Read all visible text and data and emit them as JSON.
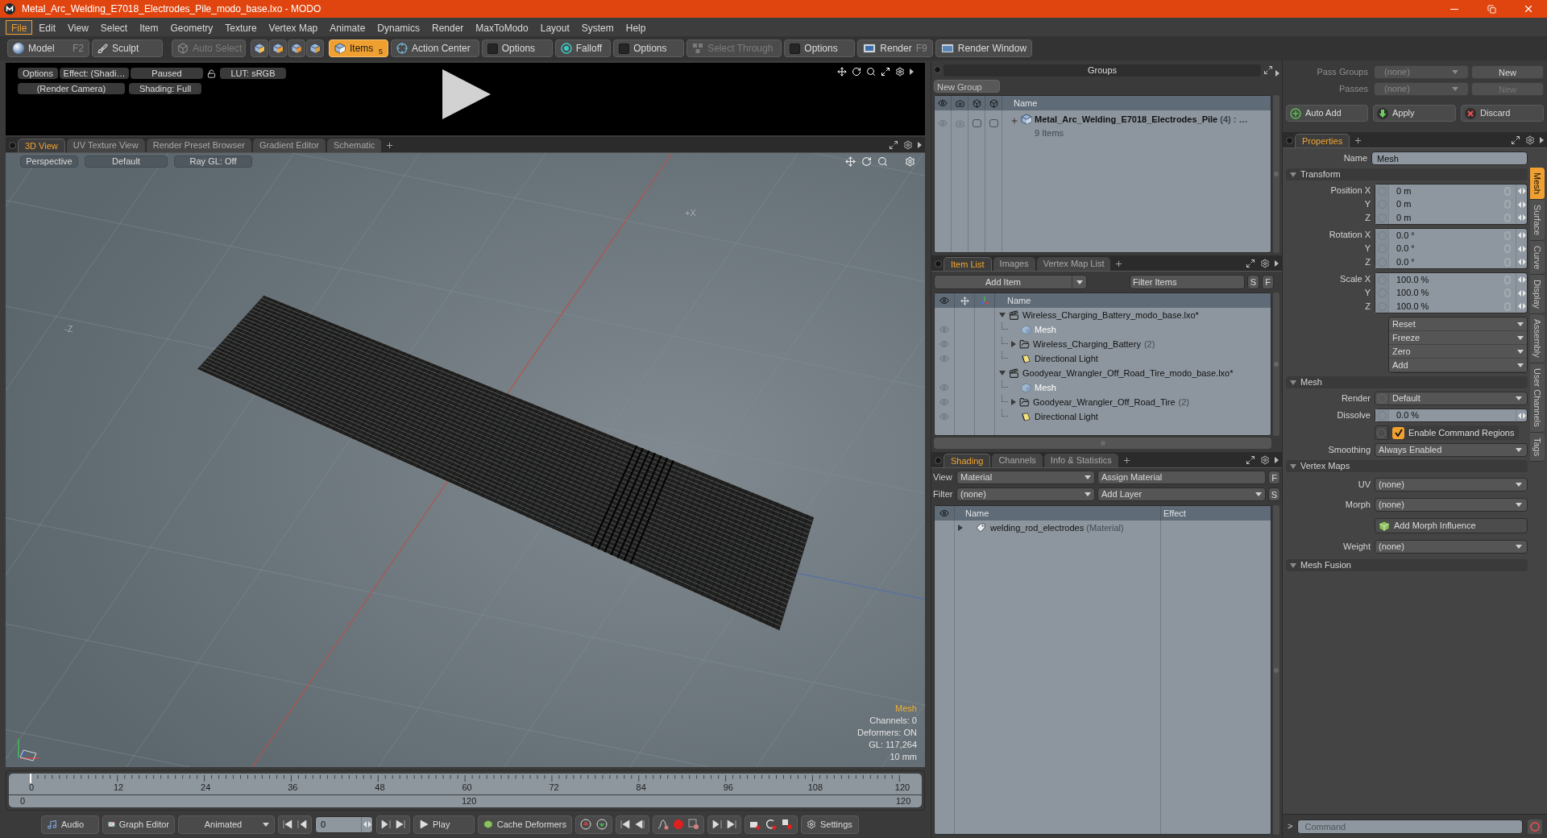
{
  "window": {
    "title": "Metal_Arc_Welding_E7018_Electrodes_Pile_modo_base.lxo - MODO"
  },
  "menu": [
    {
      "label": "File",
      "selected": true
    },
    {
      "label": "Edit",
      "selected": false
    },
    {
      "label": "View",
      "selected": false
    },
    {
      "label": "Select",
      "selected": false
    },
    {
      "label": "Item",
      "selected": false
    },
    {
      "label": "Geometry",
      "selected": false
    },
    {
      "label": "Texture",
      "selected": false
    },
    {
      "label": "Vertex Map",
      "selected": false
    },
    {
      "label": "Animate",
      "selected": false
    },
    {
      "label": "Dynamics",
      "selected": false
    },
    {
      "label": "Render",
      "selected": false
    },
    {
      "label": "MaxToModo",
      "selected": false
    },
    {
      "label": "Layout",
      "selected": false
    },
    {
      "label": "System",
      "selected": false
    },
    {
      "label": "Help",
      "selected": false
    }
  ],
  "toolbar": {
    "modes": [
      {
        "label": "Model",
        "shortcut": "F2"
      },
      {
        "label": "Sculpt"
      }
    ],
    "auto_select": {
      "label": "Auto Select",
      "disabled": true
    },
    "selection_modes": [
      {
        "selected": false
      },
      {
        "selected": false
      },
      {
        "selected": false
      },
      {
        "selected": false
      },
      {
        "label": "Items",
        "count": "5",
        "selected": true
      }
    ],
    "tools": [
      {
        "kind": "action_center",
        "label": "Action Center",
        "disabled": false
      },
      {
        "kind": "options",
        "label": "Options",
        "disabled": false
      },
      {
        "kind": "falloff",
        "label": "Falloff",
        "disabled": false
      },
      {
        "kind": "options",
        "label": "Options",
        "disabled": false
      },
      {
        "kind": "select_through",
        "label": "Select Through",
        "disabled": true
      },
      {
        "kind": "options",
        "label": "Options",
        "disabled": false
      }
    ],
    "render": [
      {
        "kind": "render",
        "label": "Render",
        "shortcut": "F9"
      },
      {
        "kind": "render_window",
        "label": "Render Window"
      }
    ]
  },
  "preview": {
    "row_1": [
      "Options",
      "Effect: (Shadi…",
      "Paused"
    ],
    "lut": "LUT: sRGB",
    "row_2": [
      "(Render Camera)",
      "Shading: Full"
    ]
  },
  "viewport": {
    "tabs": [
      {
        "label": "3D View",
        "selected": true
      },
      {
        "label": "UV Texture View",
        "selected": false
      },
      {
        "label": "Render Preset Browser",
        "selected": false
      },
      {
        "label": "Gradient Editor",
        "selected": false
      },
      {
        "label": "Schematic",
        "selected": false
      }
    ],
    "buttons": [
      "Perspective",
      "Default",
      "Ray GL: Off"
    ],
    "axis_labels": [
      "+X",
      "-Z"
    ],
    "info": {
      "title": "Mesh",
      "lines": [
        "Channels: 0",
        "Deformers: ON",
        "GL: 117,264",
        "10 mm"
      ]
    }
  },
  "timeline": {
    "ticks": [
      "0",
      "12",
      "24",
      "36",
      "48",
      "60",
      "72",
      "84",
      "96",
      "108",
      "120"
    ],
    "range": [
      "0",
      "120",
      "120"
    ]
  },
  "transport": {
    "audio": "Audio",
    "graph_editor": "Graph Editor",
    "mode": "Animated",
    "frame": "0",
    "play": "Play",
    "cache": "Cache Deformers",
    "settings": "Settings"
  },
  "groups": {
    "title": "Groups",
    "new_group": "New Group",
    "column": "Name",
    "rows": [
      {
        "name": "Metal_Arc_Welding_E7018_Electrodes_Pile",
        "count": "(4) : …",
        "subtitle": "9 Items",
        "expanded": false
      }
    ]
  },
  "item_list": {
    "tabs": [
      {
        "label": "Item List",
        "selected": true
      },
      {
        "label": "Images",
        "selected": false
      },
      {
        "label": "Vertex Map List",
        "selected": false
      }
    ],
    "add_item": "Add Item",
    "filter_placeholder": "Filter Items",
    "buttons": [
      "S",
      "F"
    ],
    "column": "Name",
    "tree": [
      {
        "kind": "scene",
        "name": "Wireless_Charging_Battery_modo_base.lxo*",
        "expanded": true,
        "children": [
          {
            "kind": "mesh",
            "name": "Mesh",
            "dimmed": true
          },
          {
            "kind": "group",
            "name": "Wireless_Charging_Battery",
            "count": "(2)",
            "expanded": false,
            "dimmed": false
          },
          {
            "kind": "light",
            "name": "Directional Light",
            "dimmed": false
          }
        ]
      },
      {
        "kind": "scene",
        "name": "Goodyear_Wrangler_Off_Road_Tire_modo_base.lxo*",
        "expanded": true,
        "children": [
          {
            "kind": "mesh",
            "name": "Mesh",
            "dimmed": true
          },
          {
            "kind": "group",
            "name": "Goodyear_Wrangler_Off_Road_Tire",
            "count": "(2)",
            "expanded": false,
            "dimmed": false
          },
          {
            "kind": "light",
            "name": "Directional Light",
            "dimmed": false
          }
        ]
      }
    ]
  },
  "shading": {
    "tabs": [
      {
        "label": "Shading",
        "selected": true
      },
      {
        "label": "Channels",
        "selected": false
      },
      {
        "label": "Info & Statistics",
        "selected": false
      }
    ],
    "view_label": "View",
    "view": "Material",
    "assign": "Assign Material",
    "filter_label": "Filter",
    "filter": "(none)",
    "add_layer": "Add Layer",
    "buttons": [
      "F",
      "S"
    ],
    "columns": [
      "Name",
      "Effect"
    ],
    "rows": [
      {
        "name": "welding_rod_electrodes",
        "type": "(Material)",
        "expanded": false
      }
    ]
  },
  "passes": {
    "rows": [
      {
        "label": "Pass Groups",
        "value": "(none)",
        "button": "New",
        "disabled": false
      },
      {
        "label": "Passes",
        "value": "(none)",
        "button": "New",
        "disabled": true
      }
    ],
    "actions": [
      {
        "kind": "add",
        "label": "Auto Add"
      },
      {
        "kind": "apply",
        "label": "Apply"
      },
      {
        "kind": "discard",
        "label": "Discard"
      }
    ]
  },
  "properties": {
    "tabs": [
      {
        "label": "Properties",
        "selected": true
      }
    ],
    "name_label": "Name",
    "name": "Mesh",
    "sections": [
      {
        "title": "Transform",
        "expanded": true,
        "rows": [
          {
            "kind": "vector",
            "items": [
              {
                "label": "Position X",
                "value": "0 m"
              },
              {
                "label": "Y",
                "value": "0 m"
              },
              {
                "label": "Z",
                "value": "0 m"
              }
            ]
          },
          {
            "kind": "vector",
            "items": [
              {
                "label": "Rotation X",
                "value": "0.0 °"
              },
              {
                "label": "Y",
                "value": "0.0 °"
              },
              {
                "label": "Z",
                "value": "0.0 °"
              }
            ]
          },
          {
            "kind": "vector",
            "items": [
              {
                "label": "Scale X",
                "value": "100.0 %"
              },
              {
                "label": "Y",
                "value": "100.0 %"
              },
              {
                "label": "Z",
                "value": "100.0 %"
              }
            ]
          },
          {
            "kind": "menus",
            "items": [
              "Reset",
              "Freeze",
              "Zero",
              "Add"
            ]
          }
        ]
      },
      {
        "title": "Mesh",
        "expanded": true,
        "rows": [
          {
            "kind": "channel_dropdown",
            "label": "Render",
            "value": "Default"
          },
          {
            "kind": "number",
            "label": "Dissolve",
            "value": "0.0 %"
          },
          {
            "kind": "checkbox",
            "label": "Enable Command Regions",
            "checked": true
          },
          {
            "kind": "dropdown",
            "label": "Smoothing",
            "value": "Always Enabled"
          }
        ]
      },
      {
        "title": "Vertex Maps",
        "expanded": true,
        "rows": [
          {
            "kind": "dropdown",
            "label": "UV",
            "value": "(none)"
          },
          {
            "kind": "dropdown",
            "label": "Morph",
            "value": "(none)"
          },
          {
            "kind": "button",
            "label": "Add Morph Influence"
          },
          {
            "kind": "dropdown",
            "label": "Weight",
            "value": "(none)"
          }
        ]
      },
      {
        "title": "Mesh Fusion",
        "expanded": true
      }
    ],
    "side_tabs": [
      {
        "label": "Mesh",
        "selected": true
      },
      {
        "label": "Surface",
        "selected": false
      },
      {
        "label": "Curve",
        "selected": false
      },
      {
        "label": "Display",
        "selected": false
      },
      {
        "label": "Assembly",
        "selected": false
      },
      {
        "label": "User Channels",
        "selected": false
      },
      {
        "label": "Tags",
        "selected": false
      }
    ]
  },
  "command": {
    "prompt": ">",
    "placeholder": "Command"
  }
}
